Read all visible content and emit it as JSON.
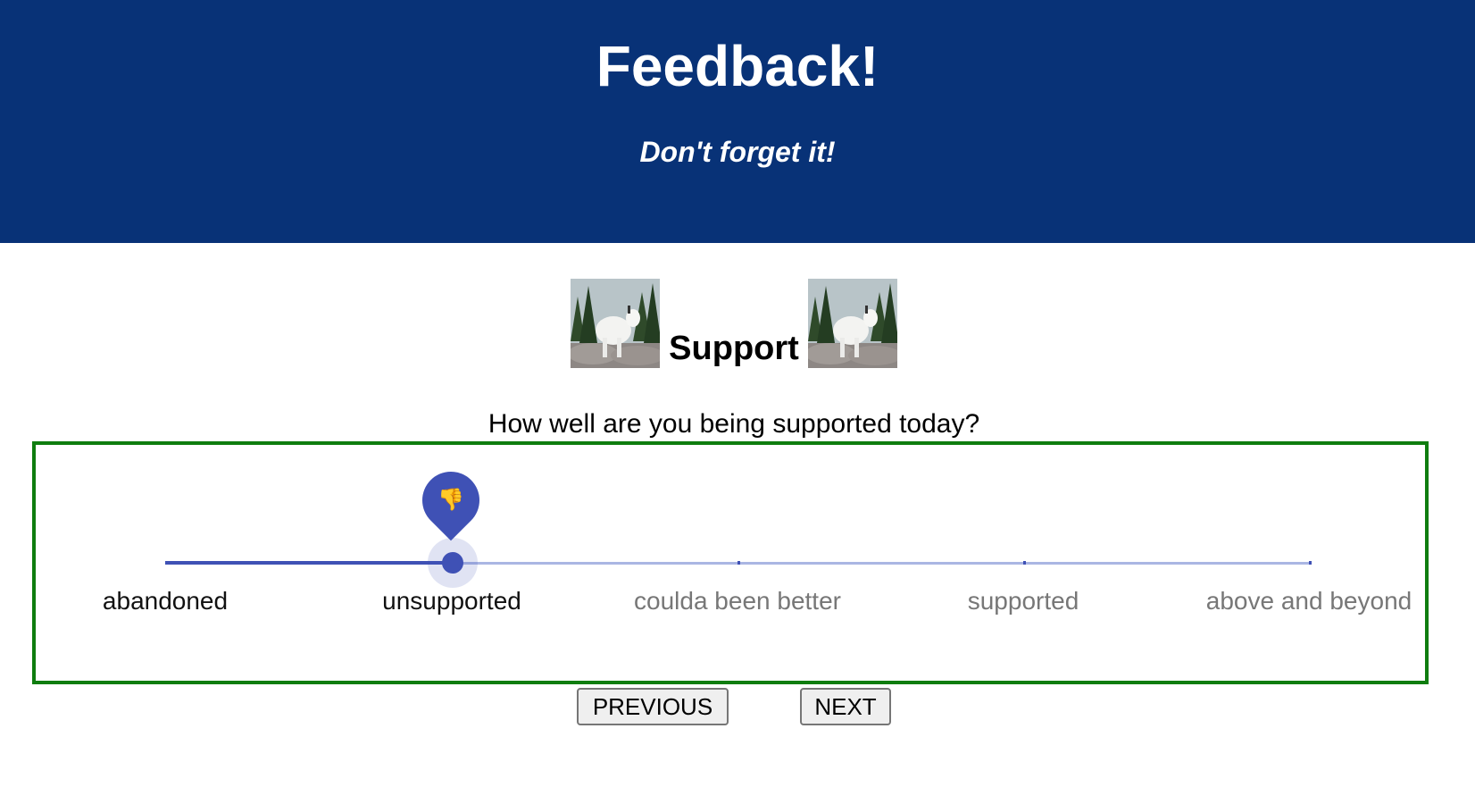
{
  "header": {
    "title": "Feedback!",
    "subtitle": "Don't forget it!"
  },
  "section": {
    "title": "Support",
    "question": "How well are you being supported today?",
    "image_alt": "mountain goat"
  },
  "slider": {
    "marks": [
      {
        "label": "abandoned"
      },
      {
        "label": "unsupported"
      },
      {
        "label": "coulda been better"
      },
      {
        "label": "supported"
      },
      {
        "label": "above and beyond"
      }
    ],
    "selected_index": 1,
    "selected_label": "unsupported",
    "value_icon": "thumbs-down-icon",
    "value_glyph": "👎"
  },
  "nav": {
    "previous_label": "PREVIOUS",
    "next_label": "NEXT"
  },
  "colors": {
    "header_bg": "#083277",
    "slider_primary": "#3f51b5",
    "slider_track_inactive": "#aab6e3",
    "container_border": "#0f7d0f"
  }
}
